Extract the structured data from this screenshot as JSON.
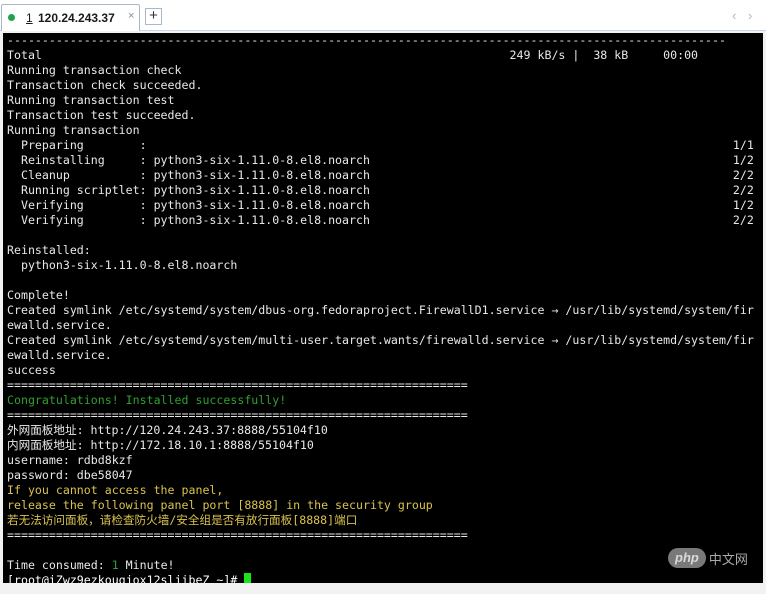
{
  "tab": {
    "number": "1",
    "host": "120.24.243.37",
    "close": "×",
    "status_color": "#22a34a"
  },
  "new_tab": "+",
  "nav": {
    "left": "‹",
    "right": "›"
  },
  "colors": {
    "text": "#e8e8e8",
    "green": "#30a030",
    "yellow": "#d9c24c",
    "cursor": "#19e619",
    "prompt": "#ffffff"
  },
  "terminal": {
    "lines": [
      "-------------------------------------------------------------------------------------------------------",
      "Total                                                                   249 kB/s |  38 kB     00:00",
      "Running transaction check",
      "Transaction check succeeded.",
      "Running transaction test",
      "Transaction test succeeded.",
      "Running transaction",
      "  Preparing        :                                                                                    1/1",
      "  Reinstalling     : python3-six-1.11.0-8.el8.noarch                                                    1/2",
      "  Cleanup          : python3-six-1.11.0-8.el8.noarch                                                    2/2",
      "  Running scriptlet: python3-six-1.11.0-8.el8.noarch                                                    2/2",
      "  Verifying        : python3-six-1.11.0-8.el8.noarch                                                    1/2",
      "  Verifying        : python3-six-1.11.0-8.el8.noarch                                                    2/2",
      "",
      "Reinstalled:",
      "  python3-six-1.11.0-8.el8.noarch",
      "",
      "Complete!",
      "Created symlink /etc/systemd/system/dbus-org.fedoraproject.FirewallD1.service → /usr/lib/systemd/system/fir",
      "ewalld.service.",
      "Created symlink /etc/systemd/system/multi-user.target.wants/firewalld.service → /usr/lib/systemd/system/fir",
      "ewalld.service.",
      "success",
      "==================================================================",
      "Congratulations! Installed successfully!",
      "==================================================================",
      "外网面板地址: http://120.24.243.37:8888/55104f10",
      "内网面板地址: http://172.18.10.1:8888/55104f10",
      "username: rdbd8kzf",
      "password: dbe58047",
      "If you cannot access the panel,",
      "release the following panel port [8888] in the security group",
      "若无法访问面板，请检查防火墙/安全组是否有放行面板[8888]端口",
      "==================================================================",
      "",
      "Time consumed: ",
      "[root@iZwz9ezkouqjox12sljibeZ ~]# "
    ],
    "time_value": "1",
    "time_unit": " Minute!"
  },
  "watermark": {
    "logo": "php",
    "text": "中文网"
  }
}
